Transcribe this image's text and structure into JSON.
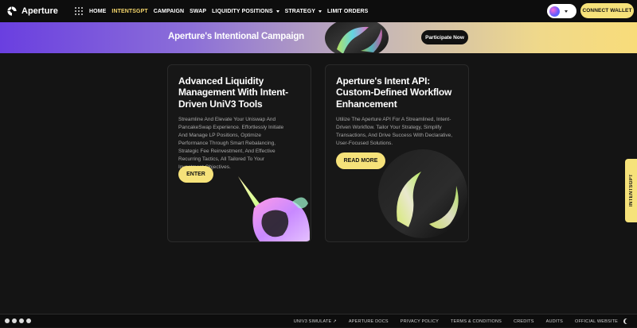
{
  "header": {
    "logo_text": "Aperture",
    "nav": [
      {
        "label": "HOME",
        "active": false
      },
      {
        "label": "INTENTSGPT",
        "active": true
      },
      {
        "label": "CAMPAIGN",
        "active": false
      },
      {
        "label": "SWAP",
        "active": false
      },
      {
        "label": "LIQUIDITY POSITIONS",
        "active": false,
        "dropdown": true
      },
      {
        "label": "STRATEGY",
        "active": false,
        "dropdown": true
      },
      {
        "label": "LIMIT ORDERS",
        "active": false
      }
    ],
    "connect_label": "CONNECT WALLET"
  },
  "banner": {
    "title": "Aperture's Intentional Campaign",
    "button_label": "Participate Now"
  },
  "cards": [
    {
      "title": "Advanced Liquidity Management With Intent-Driven UniV3 Tools",
      "description": "Streamline And Elevate Your Uniswap And PancakeSwap Experience. Effortlessly Initiate And Manage LP Positions, Optimize Performance Through Smart Rebalancing, Strategic Fee Reinvestment, And Effective Recurring Tactics, All Tailored To Your Investment Objectives.",
      "button_label": "ENTER"
    },
    {
      "title": "Aperture's Intent API: Custom-Defined Workflow Enhancement",
      "description": "Utilize The Aperture API For A Streamlined, Intent-Driven Workflow. Tailor Your Strategy, Simplify Transactions, And Drive Success With Declarative, User-Focused Solutions.",
      "button_label": "READ MORE"
    }
  ],
  "side_tab_label": "INTENTSGPT",
  "footer": {
    "links": [
      "UNIV3 SIMULATE ↗",
      "APERTURE DOCS",
      "PRIVACY POLICY",
      "TERMS & CONDITIONS",
      "CREDITS",
      "AUDITS",
      "OFFICIAL WEBSITE"
    ]
  },
  "colors": {
    "accent_yellow": "#f6e27a",
    "active_nav": "#f5d66b",
    "background": "#141414",
    "banner_start": "#6a3fe0",
    "banner_end": "#f8dc7a"
  }
}
